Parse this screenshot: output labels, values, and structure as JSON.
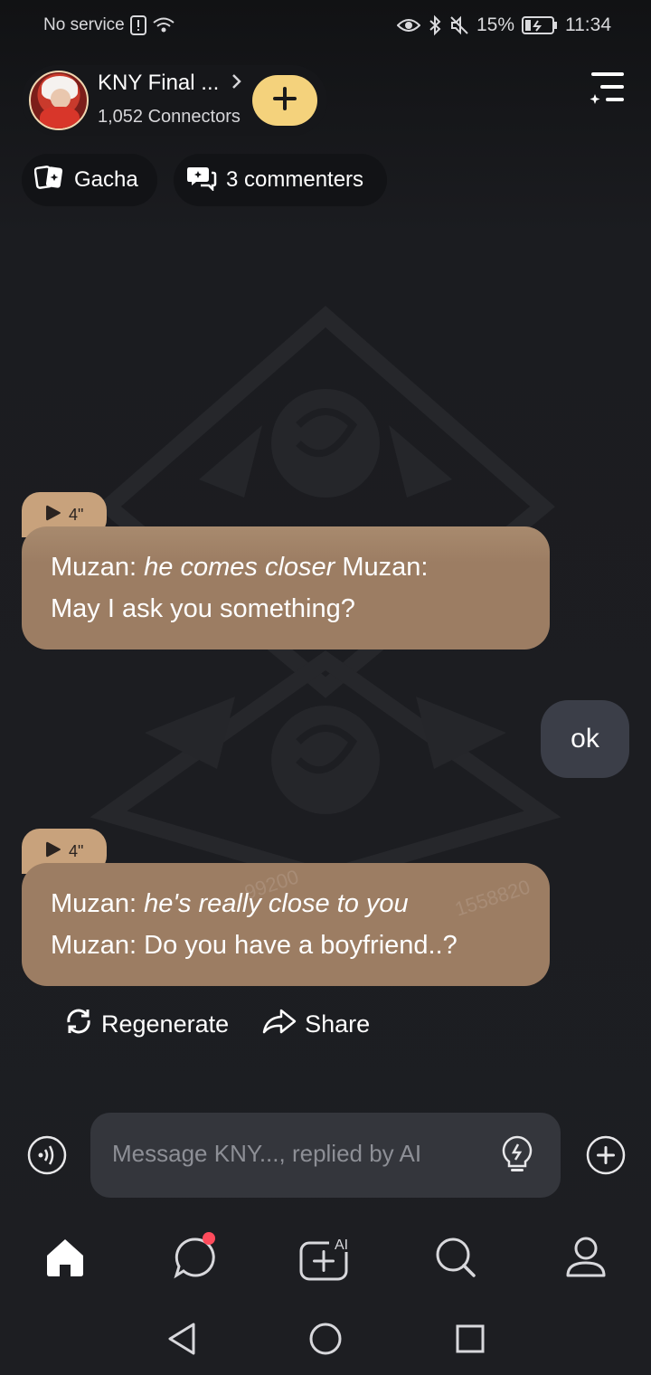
{
  "status_bar": {
    "carrier": "No service",
    "battery": "15%",
    "time": "11:34"
  },
  "header": {
    "title": "KNY Final ...",
    "connectors": "1,052 Connectors",
    "add_icon": "plus-icon",
    "menu_icon": "menu-sparkle-icon"
  },
  "chips": {
    "gacha": "Gacha",
    "commenters": "3 commenters"
  },
  "messages": {
    "m1": {
      "duration": "4\"",
      "speaker_a": "Muzan: ",
      "action": "he comes closer",
      "speaker_b": " Muzan:",
      "line2": "May I ask you something?"
    },
    "user": {
      "text": "ok"
    },
    "m2": {
      "duration": "4\"",
      "speaker_a": "Muzan: ",
      "action": "he's really close to you",
      "line2": "Muzan: Do you have a boyfriend..?",
      "watermark1": "...99200",
      "watermark2": "1558820"
    }
  },
  "actions": {
    "regenerate": "Regenerate",
    "share": "Share"
  },
  "composer": {
    "placeholder": "Message KNY..., replied by AI"
  },
  "nav": {
    "items": [
      "home-icon",
      "chat-icon",
      "create-ai-icon",
      "search-icon",
      "profile-icon"
    ]
  },
  "colors": {
    "ai_bubble": "#9c7d63",
    "duration_tag": "#c8a27c",
    "user_bubble": "#3b3e48",
    "accent_yellow": "#f4d27c",
    "badge_red": "#ff4b5c"
  }
}
